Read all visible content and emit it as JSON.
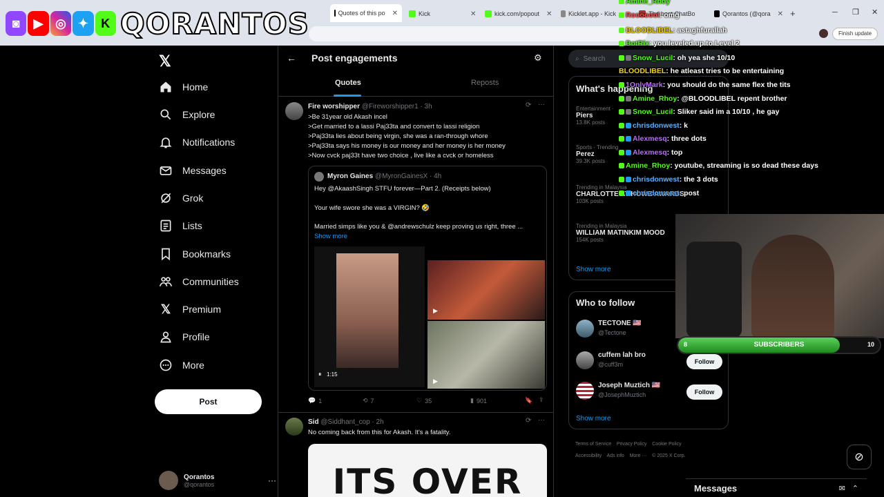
{
  "browser": {
    "tabs": [
      {
        "label": "Quotes of this po",
        "active": true
      },
      {
        "label": "Kick"
      },
      {
        "label": "kick.com/popout"
      },
      {
        "label": "Kicklet.app - Kick"
      },
      {
        "label": "The best ChatBo"
      },
      {
        "label": "Qorantos (@qora"
      }
    ],
    "finish_update": "Finish update"
  },
  "overlay": {
    "channel_name": "QORANTOS"
  },
  "nav": {
    "items": [
      "Home",
      "Explore",
      "Notifications",
      "Messages",
      "Grok",
      "Lists",
      "Bookmarks",
      "Communities",
      "Premium",
      "Profile",
      "More"
    ],
    "post_button": "Post",
    "account": {
      "name": "Qorantos",
      "handle": "@qorantos"
    }
  },
  "page": {
    "title": "Post engagements",
    "tabs": [
      "Quotes",
      "Reposts"
    ]
  },
  "tweet1": {
    "name": "Fire worshipper",
    "handle": "@Fireworshipper1",
    "time": "· 3h",
    "lines": [
      ">Be 31year old Akash incel",
      ">Get married to a lassi Paj33ta and convert to lassi religion",
      ">Paj33ta lies about being virgin, she was a ran-through whore",
      ">Paj33ta says his money is our money and her money is her money",
      ">Now cvck paj33t have two choice , live like a cvck or homeless"
    ],
    "quote": {
      "name": "Myron Gaines",
      "handle": "@MyronGainesX",
      "time": "· 4h",
      "line1": "Hey @AkaashSingh STFU forever—Part 2. (Receipts below)",
      "line2": "Your wife swore she was a VIRGIN? 🤣",
      "line3": "Married simps like you & @andrewschulz keep proving us right, three ...",
      "show_more": "Show more",
      "video_time": "1:15"
    },
    "replies": "1",
    "reposts": "7",
    "likes": "35",
    "views": "901"
  },
  "tweet2": {
    "name": "Sid",
    "handle": "@Siddhant_cop",
    "time": "· 2h",
    "text": "No coming back from this for Akash. It's a fatality.",
    "image_text": "ITS OVER"
  },
  "right": {
    "search_placeholder": "Search",
    "happening_title": "What's happening",
    "trends": [
      {
        "sub": "Entertainment ·",
        "title": "Piers",
        "count": "13.8K posts"
      },
      {
        "sub": "Sports · Trending",
        "title": "Perez",
        "count": "39.3K posts"
      },
      {
        "sub": "Trending in Malaysia",
        "title": "CHARLOTTE AT HOWE AWARDS",
        "count": "103K posts"
      },
      {
        "sub": "Trending in Malaysia",
        "title": "WILLIAM MATINKIM MOOD",
        "count": "154K posts"
      }
    ],
    "show_more": "Show more",
    "who_title": "Who to follow",
    "who": [
      {
        "name": "TECTONE 🇺🇸",
        "handle": "@Tectone"
      },
      {
        "name": "cuffem lah bro",
        "handle": "@cuff3m"
      },
      {
        "name": "Joseph Muztich 🇺🇸",
        "handle": "@JosephMuztich"
      }
    ],
    "follow_label": "Follow",
    "footer1": "Terms of Service    Privacy Policy    Cookie Policy",
    "footer2": "Accessibility    Ads info    More ···    © 2025 X Corp."
  },
  "chat": [
    {
      "user": "Amine_Rhoy",
      "msg": ""
    },
    {
      "user": "Rooooool",
      "msg": ": omg"
    },
    {
      "user": "BLOODLIBEL",
      "msg": ": astaghfurallah"
    },
    {
      "user": "BotRix",
      "msg": ": you leveled up to Level 2"
    },
    {
      "user": "Snow_Lucil",
      "msg": ": oh yea she 10/10"
    },
    {
      "user": "BLOODLIBEL",
      "msg": ": he atleast tries to be entertaining"
    },
    {
      "user": "1OnlyMark",
      "msg": ": you should do the same flex the tits"
    },
    {
      "user": "Amine_Rhoy",
      "msg": ": @BLOODLIBEL repent brother"
    },
    {
      "user": "Snow_Lucil",
      "msg": ": Sliker said im a 10/10 , he gay"
    },
    {
      "user": "chrisdonwest",
      "msg": ": k"
    },
    {
      "user": "Alexmesq",
      "msg": ": three dots"
    },
    {
      "user": "Alexmesq",
      "msg": ": top"
    },
    {
      "user": "Amine_Rhoy",
      "msg": ": youtube, streaming is so dead these days"
    },
    {
      "user": "chrisdonwest",
      "msg": ": the 3 dots"
    },
    {
      "user": "chrisdonwest",
      "msg": ": post"
    }
  ],
  "subs": {
    "current": "8",
    "label": "SUBSCRIBERS",
    "goal": "10",
    "progress": 0.8
  },
  "messages_dock": {
    "label": "Messages"
  },
  "colors": {
    "accent": "#1d9bf0",
    "kick_green": "#53fc18"
  }
}
